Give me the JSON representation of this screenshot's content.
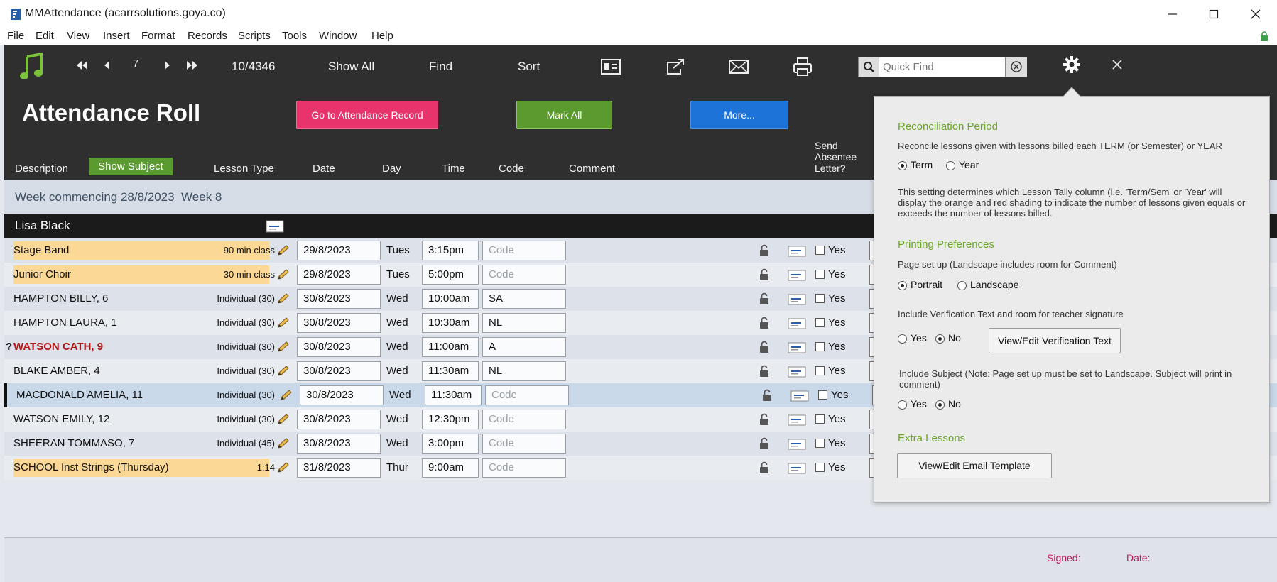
{
  "window": {
    "title": "MMAttendance (acarrsolutions.goya.co)"
  },
  "menu": [
    "File",
    "Edit",
    "View",
    "Insert",
    "Format",
    "Records",
    "Scripts",
    "Tools",
    "Window",
    "Help"
  ],
  "toolbar": {
    "record_number": "7",
    "record_count": "10/4346",
    "show_all": "Show All",
    "find": "Find",
    "sort": "Sort",
    "quick_find_placeholder": "Quick Find"
  },
  "header": {
    "title": "Attendance Roll",
    "go_button": "Go to Attendance Record",
    "mark_all_button": "Mark All",
    "more_button": "More...",
    "columns": {
      "description": "Description",
      "show_subject": "Show Subject",
      "lesson_type": "Lesson Type",
      "date": "Date",
      "day": "Day",
      "time": "Time",
      "code": "Code",
      "comment": "Comment",
      "send_absentee": "Send Absentee Letter?"
    }
  },
  "week": {
    "label": "Week commencing 28/8/2023  Week 8"
  },
  "teacher": {
    "name": "Lisa Black"
  },
  "rows": [
    {
      "name": "Stage Band",
      "lesson_type": "90 min class",
      "date": "29/8/2023",
      "day": "Tues",
      "time": "3:15pm",
      "code": "",
      "yes": "Yes",
      "highlight": true
    },
    {
      "name": "Junior Choir",
      "lesson_type": "30 min class",
      "date": "29/8/2023",
      "day": "Tues",
      "time": "5:00pm",
      "code": "",
      "yes": "Yes",
      "highlight": true
    },
    {
      "name": "HAMPTON BILLY, 6",
      "lesson_type": "Individual (30)",
      "date": "30/8/2023",
      "day": "Wed",
      "time": "10:00am",
      "code": "SA",
      "yes": "Yes"
    },
    {
      "name": "HAMPTON LAURA, 1",
      "lesson_type": "Individual (30)",
      "date": "30/8/2023",
      "day": "Wed",
      "time": "10:30am",
      "code": "NL",
      "yes": "Yes"
    },
    {
      "name": "WATSON CATH, 9",
      "lesson_type": "Individual (30)",
      "date": "30/8/2023",
      "day": "Wed",
      "time": "11:00am",
      "code": "A",
      "yes": "Yes",
      "flag": "?",
      "alert": true
    },
    {
      "name": "BLAKE AMBER, 4",
      "lesson_type": "Individual (30)",
      "date": "30/8/2023",
      "day": "Wed",
      "time": "11:30am",
      "code": "NL",
      "yes": "Yes"
    },
    {
      "name": "MACDONALD AMELIA, 11",
      "lesson_type": "Individual (30)",
      "date": "30/8/2023",
      "day": "Wed",
      "time": "11:30am",
      "code": "",
      "yes": "Yes",
      "selected": true
    },
    {
      "name": "WATSON EMILY, 12",
      "lesson_type": "Individual (30)",
      "date": "30/8/2023",
      "day": "Wed",
      "time": "12:30pm",
      "code": "",
      "yes": "Yes"
    },
    {
      "name": "SHEERAN TOMMASO, 7",
      "lesson_type": "Individual (45)",
      "date": "30/8/2023",
      "day": "Wed",
      "time": "3:00pm",
      "code": "",
      "yes": "Yes"
    },
    {
      "name": "SCHOOL Inst Strings (Thursday)",
      "lesson_type": "1:14",
      "date": "31/8/2023",
      "day": "Thur",
      "time": "9:00am",
      "code": "",
      "yes": "Yes",
      "highlight": true
    }
  ],
  "code_placeholder": "Code",
  "footer": {
    "signed": "Signed:",
    "date": "Date:"
  },
  "settings": {
    "recon_title": "Reconciliation Period",
    "recon_desc": "Reconcile lessons given with  lessons billed each TERM (or Semester) or YEAR",
    "term": "Term",
    "year": "Year",
    "recon_note": "This setting determines which Lesson Tally column (i.e. 'Term/Sem' or 'Year' will display the orange and red shading to indicate the number of lessons given equals or exceeds the number of lessons billed.",
    "print_title": "Printing Preferences",
    "page_setup": "Page set up (Landscape includes room for Comment)",
    "portrait": "Portrait",
    "landscape": "Landscape",
    "verif_label": "Include Verification Text and room for teacher signature",
    "yes": "Yes",
    "no": "No",
    "verif_button": "View/Edit Verification Text",
    "subject_label": "Include Subject (Note: Page set up must be set to Landscape. Subject will print in comment)",
    "extra_title": "Extra Lessons",
    "email_button": "View/Edit Email Template"
  },
  "colors": {
    "accent_green": "#6aa627",
    "pink_button": "#e8336d",
    "green_button": "#5a9a2e",
    "blue_button": "#1e73d8",
    "highlight": "#fcd896",
    "selected_row": "#c9d9ea"
  }
}
